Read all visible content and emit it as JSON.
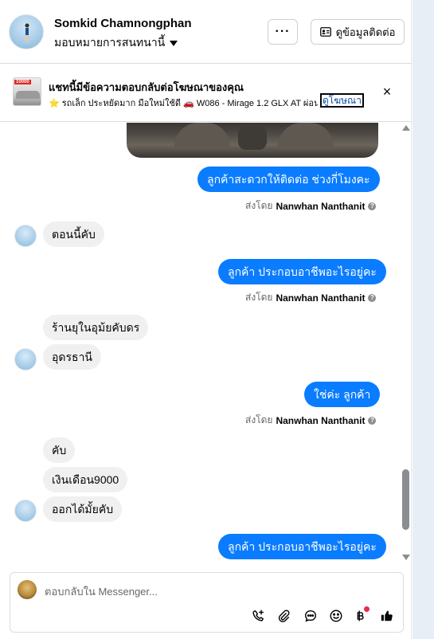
{
  "header": {
    "contact_name": "Somkid Chamnongphan",
    "assign_label": "มอบหมายการสนทนานี้",
    "more_label": "···",
    "contact_info_label": "ดูข้อมูลติดต่อ"
  },
  "ad_banner": {
    "title": "แชทนี้มีข้อความตอบกลับต่อโฆษณาของคุณ",
    "thumb_tag": "10000",
    "subtitle": "⭐ รถเล็ก ประหยัดมาก มือใหม่ใช้ดี 🚗 W086 - Mirage 1.2 GLX AT ผ่อน ...",
    "view_ad_link": "ดูโฆษณา",
    "close_label": "×"
  },
  "messages": [
    {
      "direction": "out",
      "text": "ลูกค้าสะดวกให้ติดต่อ ช่วงกี่โมงคะ"
    },
    {
      "direction": "meta",
      "prefix": "ส่งโดย",
      "sender": "Nanwhan Nanthanit"
    },
    {
      "direction": "in",
      "text": "ตอนนี้คับ"
    },
    {
      "direction": "out",
      "text": "ลูกค้า ประกอบอาชีพอะไรอยู่คะ"
    },
    {
      "direction": "meta",
      "prefix": "ส่งโดย",
      "sender": "Nanwhan Nanthanit"
    },
    {
      "direction": "in",
      "text": "ร้านยุในอุม้ยคับดร"
    },
    {
      "direction": "in",
      "text": "อุดรธานี"
    },
    {
      "direction": "out",
      "text": "ใช่ค่ะ  ลูกค้า"
    },
    {
      "direction": "meta",
      "prefix": "ส่งโดย",
      "sender": "Nanwhan Nanthanit"
    },
    {
      "direction": "in",
      "text": "คับ"
    },
    {
      "direction": "in",
      "text": "เงินเดือน9000"
    },
    {
      "direction": "in",
      "text": "ออกได้มั้ยคับ"
    },
    {
      "direction": "out",
      "text": "ลูกค้า ประกอบอาชีพอะไรอยู่คะ"
    }
  ],
  "composer": {
    "placeholder": "ตอบกลับใน Messenger...",
    "tools": [
      "call-add-icon",
      "paperclip-icon",
      "chat-bubble-icon",
      "emoji-icon",
      "baht-icon",
      "thumbs-up-icon"
    ]
  },
  "colors": {
    "outgoing_bubble": "#0a7cff",
    "incoming_bubble": "#f0f0f0",
    "notification_dot": "#f02849"
  }
}
